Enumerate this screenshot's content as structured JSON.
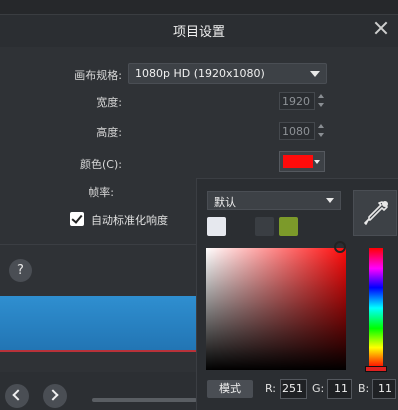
{
  "dialog": {
    "title": "项目设置"
  },
  "settings": {
    "canvas_label": "画布规格:",
    "canvas_value": "1080p HD (1920x1080)",
    "width_label": "宽度:",
    "width_value": "1920",
    "height_label": "高度:",
    "height_value": "1080",
    "color_label": "颜色(C):",
    "framerate_label": "帧率:",
    "autonormalize_label": "自动标准化响度",
    "autonormalize_checked": true
  },
  "help_label": "?",
  "color_picker": {
    "preset_value": "默认",
    "swatches": [
      "#e6e8ee",
      "#2b2e32",
      "#3a3e43",
      "#7c9a2a"
    ],
    "selected_color": "#ff0b0b",
    "mode_label": "模式",
    "r_label": "R:",
    "r_value": "251",
    "g_label": "G:",
    "g_value": "11",
    "b_label": "B:",
    "b_value": "11"
  }
}
